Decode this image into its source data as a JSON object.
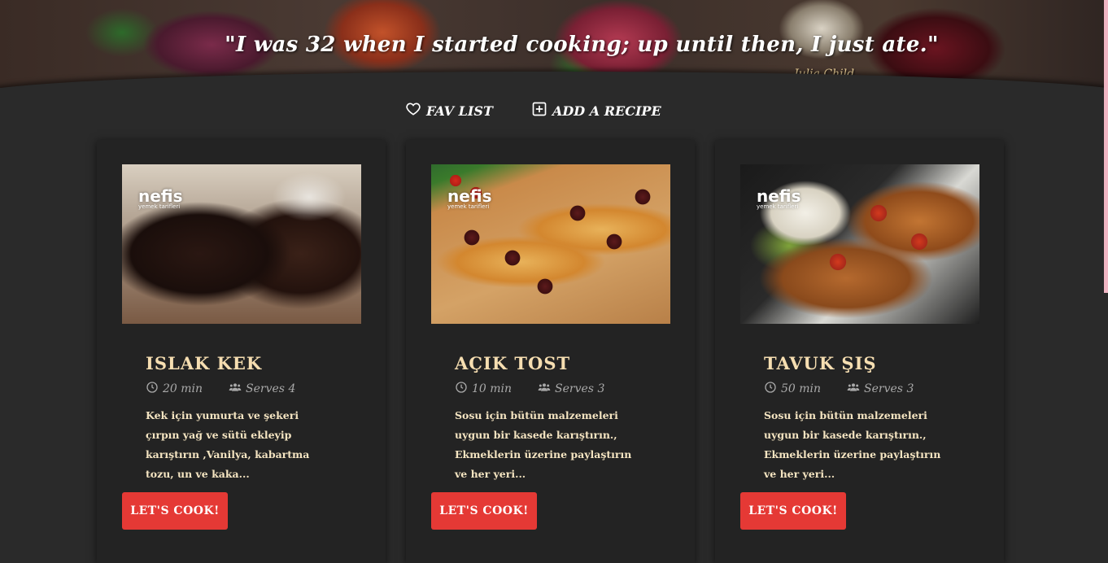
{
  "hero": {
    "quote": "\"I was 32 when I started cooking; up until then, I just ate.\"",
    "author": "Julia Child"
  },
  "nav": {
    "fav_list": "FAV LIST",
    "add_recipe": "ADD A RECIPE"
  },
  "brand_watermark": {
    "name": "nefis",
    "sub": "yemek tarifleri"
  },
  "colors": {
    "background": "#2a2a2a",
    "card": "#232323",
    "accent_button": "#e53935",
    "title_text": "#f6deb1"
  },
  "cards": [
    {
      "title": "ISLAK KEK",
      "time": "20 min",
      "serves": "Serves 4",
      "description": "Kek için yumurta ve şekeri çırpın yağ ve sütü ekleyip karıştırın ,Vanilya, kabartma tozu, un ve kaka...",
      "button": "LET'S COOK!"
    },
    {
      "title": "AÇIK TOST",
      "time": "10 min",
      "serves": "Serves 3",
      "description": "Sosu için bütün malzemeleri uygun bir kasede karıştırın., Ekmeklerin üzerine paylaştırın ve her yeri...",
      "button": "LET'S COOK!"
    },
    {
      "title": "TAVUK ŞIŞ",
      "time": "50 min",
      "serves": "Serves 3",
      "description": "Sosu için bütün malzemeleri uygun bir kasede karıştırın., Ekmeklerin üzerine paylaştırın ve her yeri...",
      "button": "LET'S COOK!"
    }
  ]
}
